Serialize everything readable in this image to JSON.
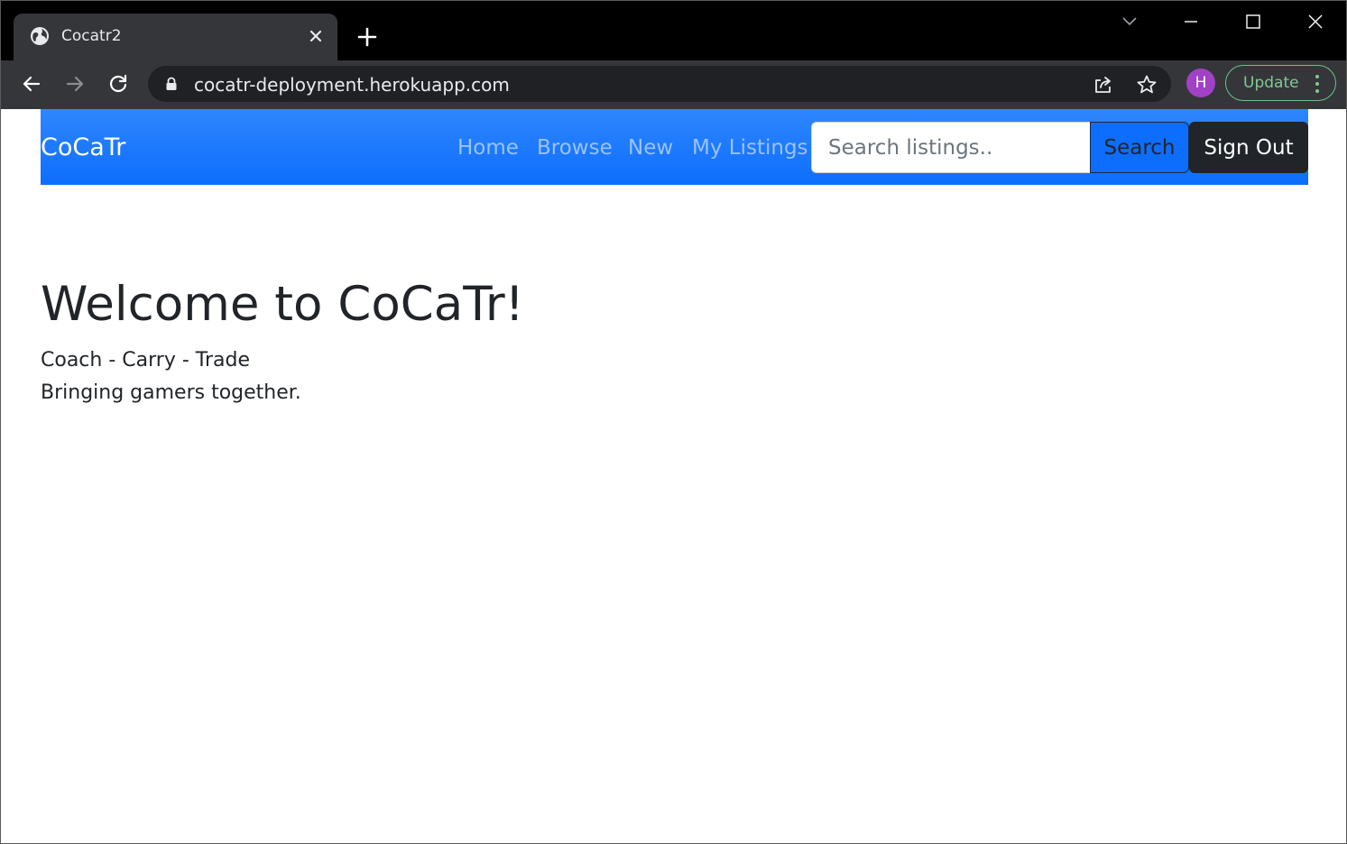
{
  "browser": {
    "tab_title": "Cocatr2",
    "url": "cocatr-deployment.herokuapp.com",
    "profile_initial": "H",
    "update_label": "Update",
    "colors": {
      "frame": "#000000",
      "toolbar": "#35363a",
      "omnibox": "#202124",
      "avatar": "#a142c6",
      "update": "#81c995"
    },
    "icons": [
      "globe-icon",
      "close-icon",
      "plus-icon",
      "chevron-down-icon",
      "minimize-icon",
      "maximize-icon",
      "window-close-icon",
      "back-arrow-icon",
      "forward-arrow-icon",
      "reload-icon",
      "lock-icon",
      "share-icon",
      "star-icon",
      "kebab-menu-icon"
    ]
  },
  "navbar": {
    "brand": "CoCaTr",
    "links": [
      "Home",
      "Browse",
      "New",
      "My Listings"
    ],
    "search_placeholder": "Search listings..",
    "search_value": "",
    "search_button": "Search",
    "signout_button": "Sign Out",
    "colors": {
      "background": "#0d6efd",
      "signout": "#212529"
    }
  },
  "hero": {
    "title": "Welcome to CoCaTr!",
    "tagline": "Coach - Carry - Trade",
    "subtitle": "Bringing gamers together."
  }
}
